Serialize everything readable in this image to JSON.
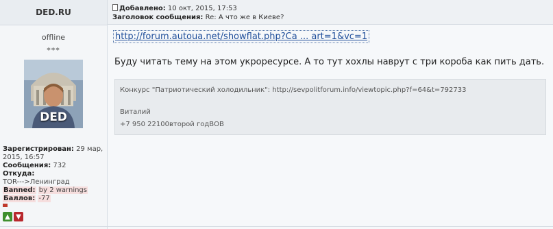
{
  "author": {
    "name": "DED.RU",
    "status": "offline",
    "rank": "***",
    "avatar_label": "DED",
    "registered_label": "Зарегистрирован:",
    "registered_value": "29 мар, 2015, 16:57",
    "posts_label": "Сообщения:",
    "posts_value": "732",
    "from_label": "Откуда:",
    "from_value": "TOR--->Ленинград",
    "banned_label": "Banned:",
    "banned_value": "by 2 warnings",
    "score_label": "Баллов:",
    "score_value": "-77"
  },
  "post": {
    "added_label": "Добавлено:",
    "added_value": "10 окт, 2015, 17:53",
    "subject_label": "Заголовок сообщения:",
    "subject_value": "Re: А что же в Киеве?",
    "link_text": "http://forum.autoua.net/showflat.php?Ca ... art=1&vc=1",
    "body": "Буду читать тему на этом укроресурсе. А то тут хохлы наврут с три короба как пить дать."
  },
  "signature": {
    "line1": "Конкурс \"Патриотический холодильник\": http://sevpolitforum.info/viewtopic.php?f=64&t=792733",
    "name": "Виталий",
    "phone": "+7 950 22100второй годВОВ"
  },
  "colors": {
    "link": "#1f4e9a",
    "vote_up": "#3f8f2e",
    "vote_down": "#b8282d",
    "banned_highlight": "#f6dede"
  }
}
